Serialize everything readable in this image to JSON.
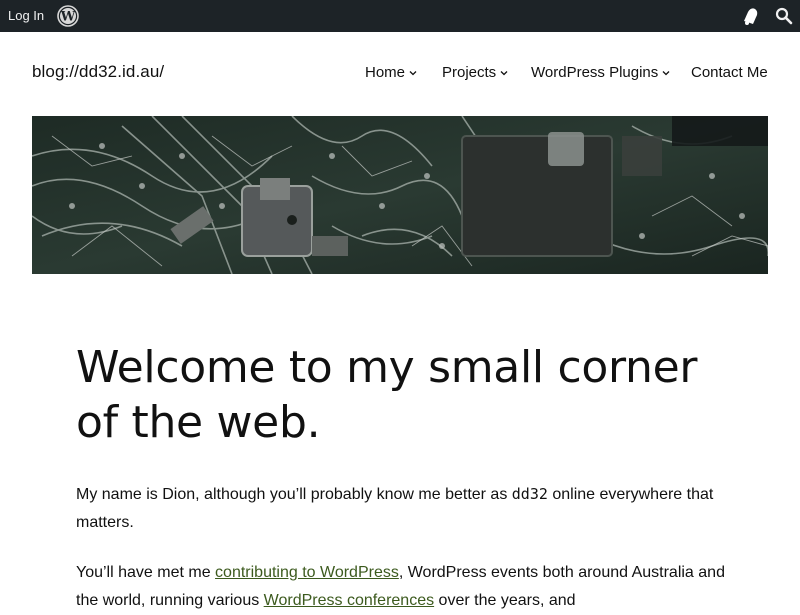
{
  "admin_bar": {
    "login_label": "Log In",
    "icons": [
      "wordpress-logo-icon",
      "notifications-bell-icon",
      "search-icon"
    ],
    "background": "#1d2327"
  },
  "header": {
    "site_title": "blog://dd32.id.au/",
    "nav": [
      {
        "label": "Home",
        "has_submenu": true
      },
      {
        "label": "Projects",
        "has_submenu": true
      },
      {
        "label": "WordPress Plugins",
        "has_submenu": true
      },
      {
        "label": "Contact Me",
        "has_submenu": false
      }
    ]
  },
  "banner": {
    "icon": "circuit-board-image"
  },
  "content": {
    "headline": "Welcome to my small corner of the web.",
    "para1_before": "My name is Dion, although you’ll probably know me better as ",
    "para1_code": "dd32",
    "para1_after": " online everywhere that matters.",
    "para2_before": "You’ll have met me ",
    "para2_link1": "contributing to WordPress",
    "para2_middle": ", WordPress events both around Australia and the world, running various ",
    "para2_link2": "WordPress conferences",
    "para2_after": " over the years, and"
  },
  "colors": {
    "link": "#3c5a1e",
    "text": "#111111"
  }
}
